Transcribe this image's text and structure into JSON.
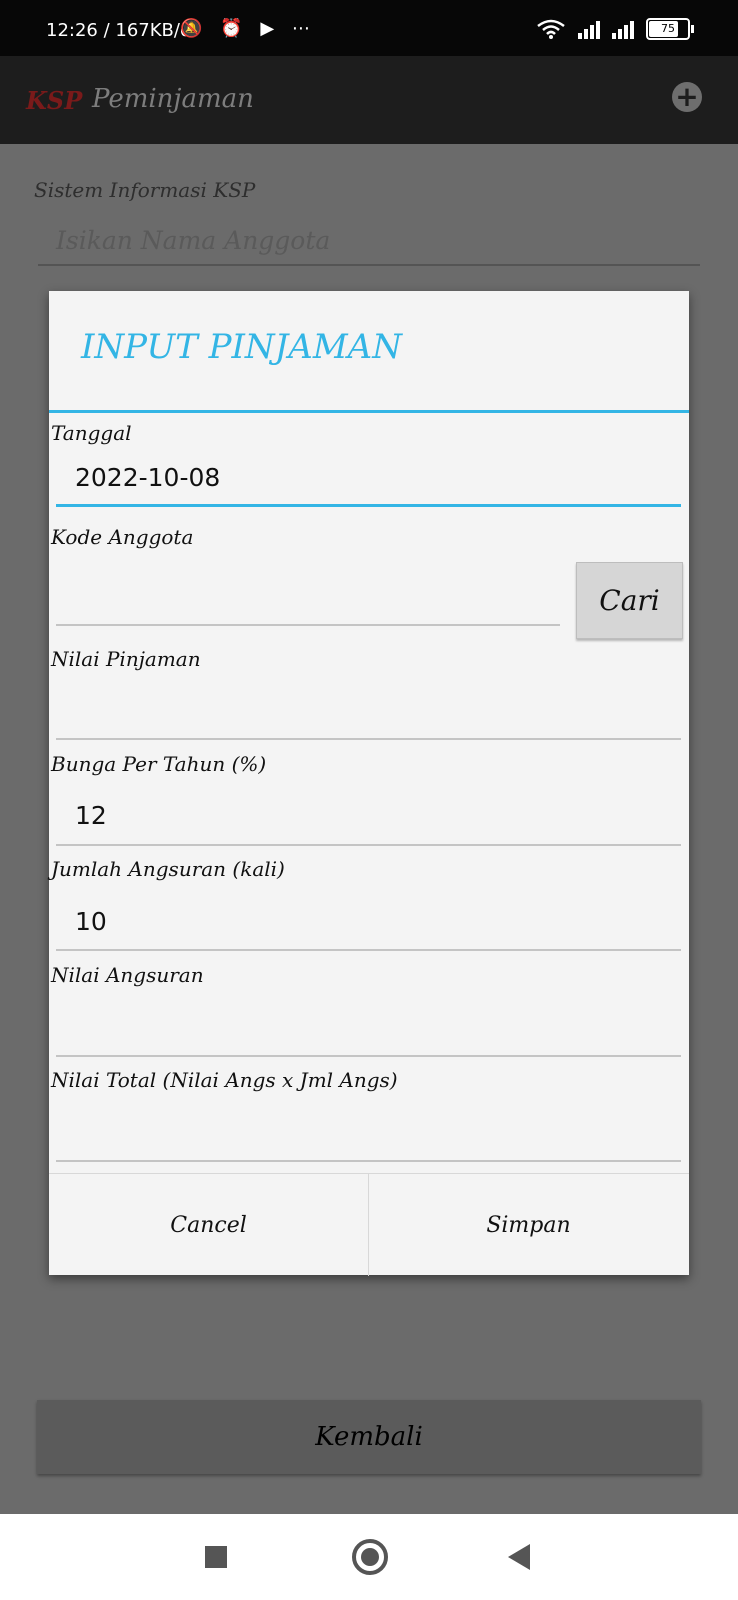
{
  "status_bar": {
    "time": "12:26 / 167KB/d",
    "battery": "75"
  },
  "app_bar": {
    "logo": "KSP",
    "title": "Peminjaman"
  },
  "background": {
    "label": "Sistem Informasi KSP",
    "search_placeholder": "Isikan Nama Anggota",
    "back_button": "Kembali"
  },
  "dialog": {
    "title": "INPUT PINJAMAN",
    "fields": {
      "tanggal": {
        "label": "Tanggal",
        "value": "2022-10-08"
      },
      "kode_anggota": {
        "label": "Kode Anggota",
        "value": ""
      },
      "nilai_pinjaman": {
        "label": "Nilai Pinjaman",
        "value": ""
      },
      "bunga": {
        "label": "Bunga Per Tahun (%)",
        "value": "12"
      },
      "jumlah_angsuran": {
        "label": "Jumlah Angsuran (kali)",
        "value": "10"
      },
      "nilai_angsuran": {
        "label": "Nilai Angsuran",
        "value": ""
      },
      "nilai_total": {
        "label": "Nilai Total (Nilai Angs x Jml Angs)",
        "value": ""
      }
    },
    "search_button": "Cari",
    "cancel_button": "Cancel",
    "save_button": "Simpan"
  },
  "colors": {
    "accent": "#33b5e5",
    "dialog_bg": "#f4f4f4",
    "scrim": "#6b6b6b"
  }
}
